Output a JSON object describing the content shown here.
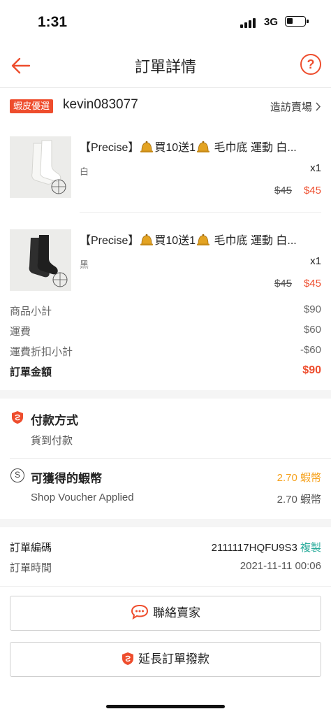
{
  "status_bar": {
    "time": "1:31",
    "network": "3G"
  },
  "header": {
    "title": "訂單詳情"
  },
  "shop": {
    "badge": "蝦皮優選",
    "name": "kevin083077",
    "visit_label": "造訪賣場"
  },
  "products": [
    {
      "title_prefix": "【Precise】",
      "title_mid": "買10送1",
      "title_suffix": " 毛巾底 運動 白...",
      "variant": "白",
      "qty": "x1",
      "original_price": "$45",
      "price": "$45",
      "sock_color": "#f4f4f2"
    },
    {
      "title_prefix": "【Precise】",
      "title_mid": "買10送1",
      "title_suffix": " 毛巾底 運動 白...",
      "variant": "黑",
      "qty": "x1",
      "original_price": "$45",
      "price": "$45",
      "sock_color": "#2a2a2a"
    }
  ],
  "summary": {
    "subtotal_label": "商品小計",
    "subtotal": "$90",
    "shipping_label": "運費",
    "shipping": "$60",
    "shipping_discount_label": "運費折扣小計",
    "shipping_discount": "-$60",
    "total_label": "訂單金額",
    "total": "$90"
  },
  "payment": {
    "title": "付款方式",
    "method": "貨到付款"
  },
  "coins": {
    "title": "可獲得的蝦幣",
    "value": "2.70 蝦幣",
    "voucher_label": "Shop Voucher Applied",
    "voucher_value": "2.70 蝦幣"
  },
  "order": {
    "id_label": "訂單編碼",
    "id": "2111117HQFU9S3",
    "copy_label": "複製",
    "time_label": "訂單時間",
    "time": "2021-11-11 00:06"
  },
  "actions": {
    "contact_label": "聯絡賣家",
    "extend_label": "延長訂單撥款"
  },
  "colors": {
    "accent": "#ee4d2d",
    "coins": "#f6a21e",
    "copy": "#26aa99"
  }
}
